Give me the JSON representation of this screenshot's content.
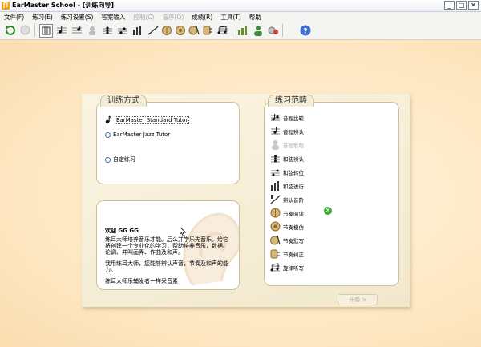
{
  "window": {
    "title": "EarMaster School - [训练向导]",
    "minimize": "_",
    "maximize": "□",
    "close": "✕"
  },
  "menu": [
    {
      "label": "文件(F)",
      "disabled": false
    },
    {
      "label": "练习(E)",
      "disabled": false
    },
    {
      "label": "练习设置(S)",
      "disabled": false
    },
    {
      "label": "答案输入",
      "disabled": false
    },
    {
      "label": "控制(C)",
      "disabled": true
    },
    {
      "label": "音序(Q)",
      "disabled": true
    },
    {
      "label": "成绩(R)",
      "disabled": false
    },
    {
      "label": "工具(T)",
      "disabled": false
    },
    {
      "label": "帮助",
      "disabled": false
    }
  ],
  "toolbar_icons": [
    "refresh-icon",
    "disabled-circle-icon",
    "keyboard-icon",
    "interval-compare-icon",
    "interval-identify-icon",
    "interval-sing-icon",
    "chord-identify-icon",
    "chord-inversion-icon",
    "chord-progression-icon",
    "scale-identify-icon",
    "rhythm-read-icon",
    "rhythm-imitate-icon",
    "rhythm-dictation-icon",
    "rhythm-correct-icon",
    "melody-dictation-icon",
    "statistics-icon",
    "user-icon",
    "settings-icon",
    "help-icon"
  ],
  "colors": {
    "background": "#fde8c4",
    "accent_blue": "#5070b0",
    "help_blue": "#3c6fd0",
    "green_badge": "#3aa83a"
  },
  "training_mode": {
    "title": "训练方式",
    "options": [
      {
        "label": "EarMaster Standard Tutor",
        "selected": true
      },
      {
        "label": "EarMaster Jazz Tutor",
        "selected": false
      },
      {
        "label": "自定练习",
        "selected": false
      }
    ]
  },
  "welcome": {
    "title": "欢迎 GG GG",
    "paragraphs": [
      "练耳大师培养音乐才能。后么并学乐先音乐。给它将创建一个专业化的学习，帮助培养音乐，数据、论调、并叫画弄、作曲及和声。",
      "我用练耳大师，您能够辨认声音，节奏及和声的能力。",
      "练耳大师乐辅发者一样采音素"
    ]
  },
  "practice_scope": {
    "title": "练习范畴",
    "items": [
      {
        "label": "音程比较",
        "icon": "interval-compare-icon",
        "disabled": false
      },
      {
        "label": "音程辨认",
        "icon": "interval-identify-icon",
        "disabled": false
      },
      {
        "label": "音程歌唱",
        "icon": "interval-sing-icon",
        "disabled": true
      },
      {
        "label": "和弦辨认",
        "icon": "chord-identify-icon",
        "disabled": false
      },
      {
        "label": "和弦转位",
        "icon": "chord-inversion-icon",
        "disabled": false
      },
      {
        "label": "和弦进行",
        "icon": "chord-progression-icon",
        "disabled": false
      },
      {
        "label": "辨认音阶",
        "icon": "scale-identify-icon",
        "disabled": false
      },
      {
        "label": "节奏阅读",
        "icon": "rhythm-read-icon",
        "disabled": false
      },
      {
        "label": "节奏模仿",
        "icon": "rhythm-imitate-icon",
        "disabled": false
      },
      {
        "label": "节奏默写",
        "icon": "rhythm-dictation-icon",
        "disabled": false
      },
      {
        "label": "节奏纠正",
        "icon": "rhythm-correct-icon",
        "disabled": false
      },
      {
        "label": "旋律听写",
        "icon": "melody-dictation-icon",
        "disabled": false
      }
    ]
  },
  "start_button": {
    "label": "开始 >"
  }
}
